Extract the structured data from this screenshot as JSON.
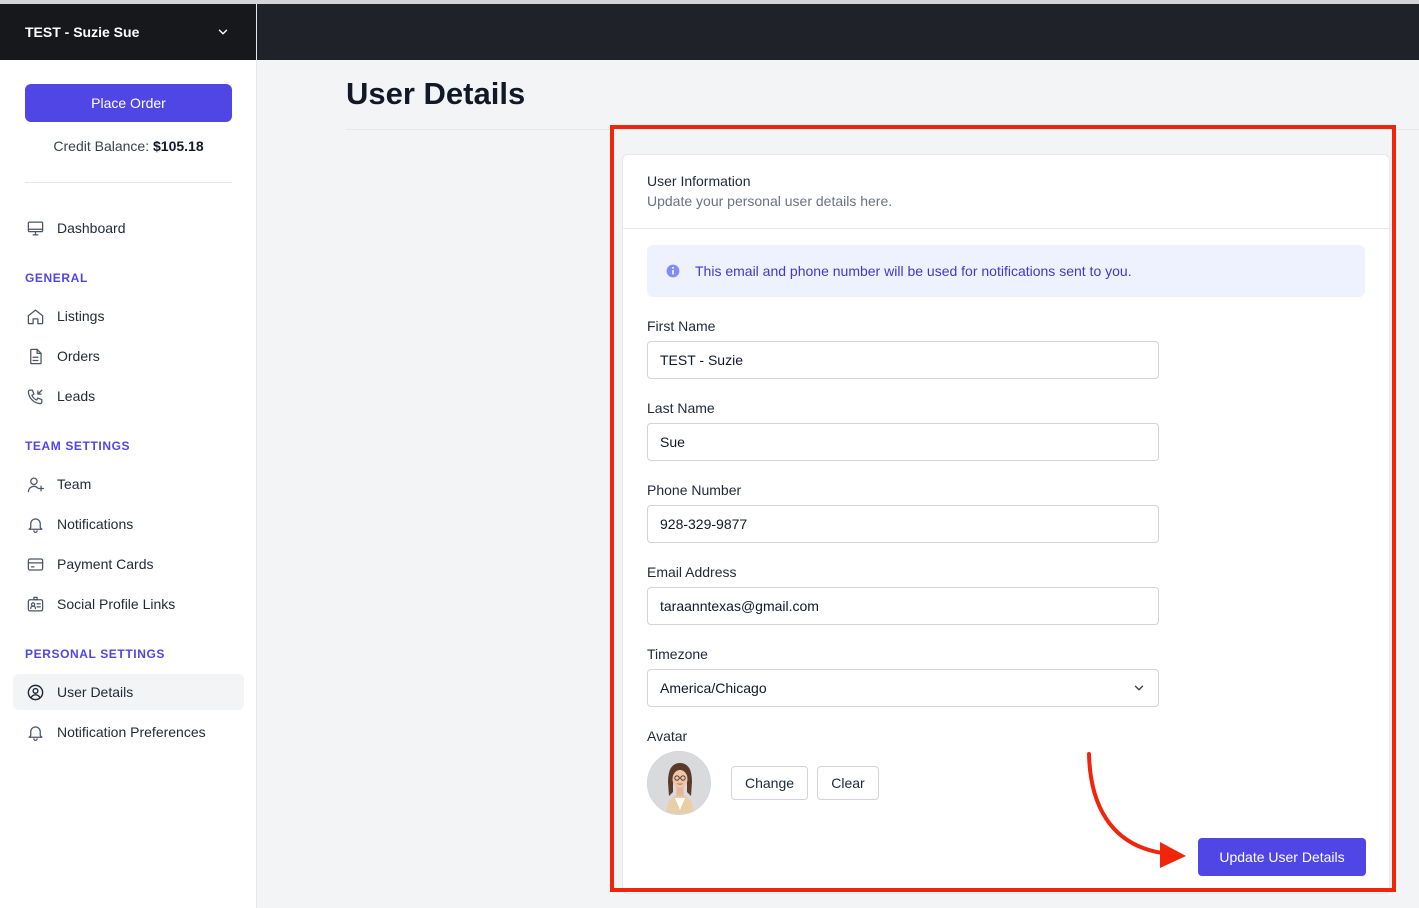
{
  "org": {
    "name": "TEST - Suzie Sue",
    "switcher_icon": "chevron-down-icon"
  },
  "sidebar": {
    "place_order_label": "Place Order",
    "credit_label": "Credit Balance: ",
    "credit_value": "$105.18",
    "dashboard": {
      "label": "Dashboard",
      "icon": "monitor-icon"
    },
    "sections": {
      "general": "GENERAL",
      "team_settings": "TEAM SETTINGS",
      "personal_settings": "PERSONAL SETTINGS"
    },
    "items": {
      "listings": {
        "label": "Listings",
        "icon": "home-icon"
      },
      "orders": {
        "label": "Orders",
        "icon": "document-icon"
      },
      "leads": {
        "label": "Leads",
        "icon": "phone-incoming-icon"
      },
      "team": {
        "label": "Team",
        "icon": "user-plus-icon"
      },
      "notifications": {
        "label": "Notifications",
        "icon": "bell-icon"
      },
      "payment_cards": {
        "label": "Payment Cards",
        "icon": "credit-card-icon"
      },
      "social_profile_links": {
        "label": "Social Profile Links",
        "icon": "id-card-icon"
      },
      "user_details": {
        "label": "User Details",
        "icon": "user-circle-icon",
        "active": true
      },
      "notification_preferences": {
        "label": "Notification Preferences",
        "icon": "bell-icon"
      }
    }
  },
  "main": {
    "title": "User Details"
  },
  "card": {
    "title": "User Information",
    "subtitle": "Update your personal user details here.",
    "info_banner": "This email and phone number will be used for notifications sent to you.",
    "fields": {
      "first_name": {
        "label": "First Name",
        "value": "TEST - Suzie"
      },
      "last_name": {
        "label": "Last Name",
        "value": "Sue"
      },
      "phone": {
        "label": "Phone Number",
        "value": "928-329-9877"
      },
      "email": {
        "label": "Email Address",
        "value": "taraanntexas@gmail.com"
      },
      "timezone": {
        "label": "Timezone",
        "value": "America/Chicago"
      }
    },
    "avatar": {
      "label": "Avatar",
      "change_label": "Change",
      "clear_label": "Clear"
    },
    "submit_label": "Update User Details"
  },
  "colors": {
    "accent": "#4f46e5",
    "topbar": "#1f2329",
    "highlight": "#f0260c",
    "info_bg": "#eef2ff"
  }
}
